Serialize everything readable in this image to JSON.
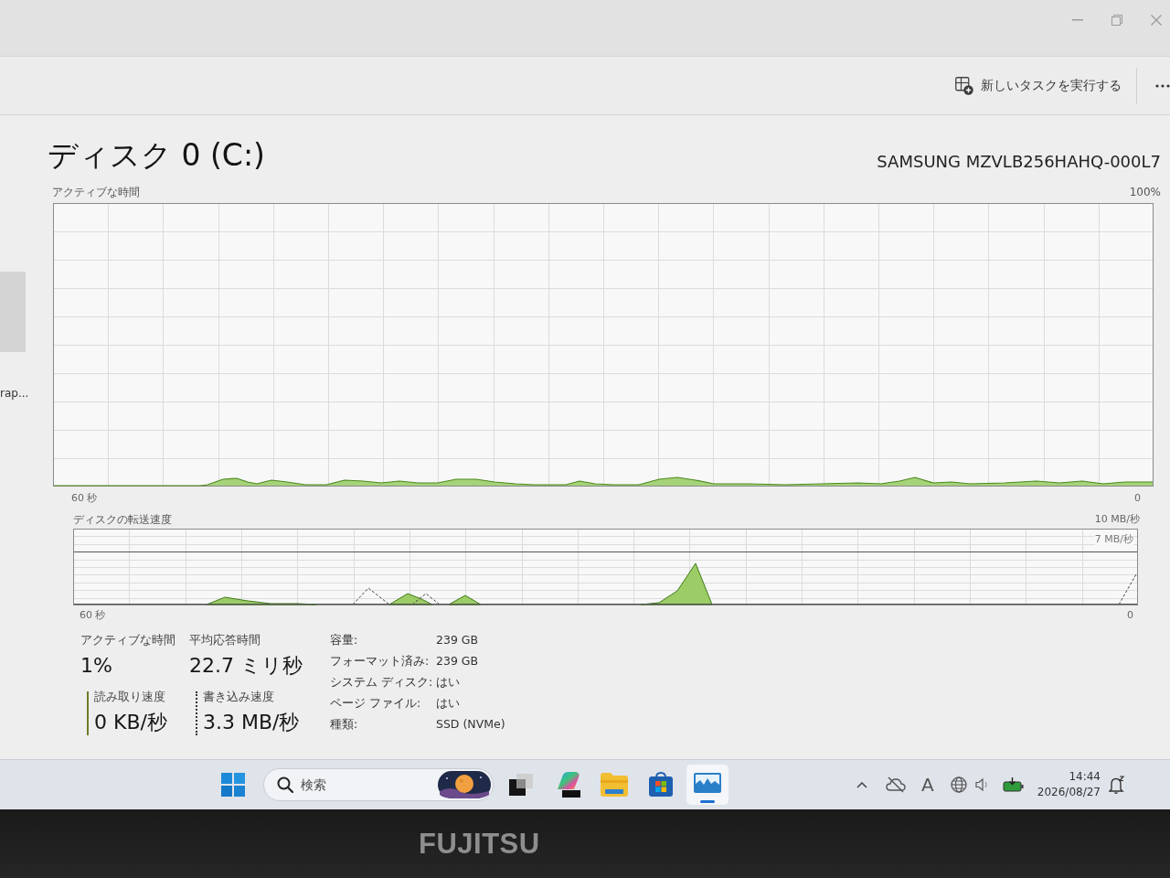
{
  "sidebar": {
    "items": [
      {
        "selected": true
      },
      {
        "label": "rap...",
        "selected": false
      }
    ]
  },
  "toolbar": {
    "run_task": "新しいタスクを実行する"
  },
  "header": {
    "title": "ディスク 0 (C:)",
    "model": "SAMSUNG MZVLB256HAHQ-000L7"
  },
  "active_time_graph": {
    "label": "アクティブな時間",
    "max": "100%",
    "span": "60 秒",
    "min": "0"
  },
  "transfer_graph": {
    "label": "ディスクの転送速度",
    "max": "10 MB/秒",
    "marker": "7 MB/秒",
    "span": "60 秒",
    "min": "0"
  },
  "metrics": [
    {
      "kind": "plain",
      "label": "アクティブな時間",
      "value": "1%"
    },
    {
      "kind": "plain",
      "label": "平均応答時間",
      "value": "22.7 ミリ秒"
    },
    {
      "kind": "solid",
      "label": "読み取り速度",
      "value": "0 KB/秒"
    },
    {
      "kind": "dotted",
      "label": "書き込み速度",
      "value": "3.3 MB/秒"
    }
  ],
  "properties": [
    {
      "label": "容量:",
      "value": "239 GB"
    },
    {
      "label": "フォーマット済み:",
      "value": "239 GB"
    },
    {
      "label": "システム ディスク:",
      "value": "はい"
    },
    {
      "label": "ページ ファイル:",
      "value": "はい"
    },
    {
      "label": "種類:",
      "value": "SSD (NVMe)"
    }
  ],
  "taskbar": {
    "search": {
      "placeholder": "検索"
    },
    "apps": [
      {
        "kind": "squares",
        "selected": false
      },
      {
        "kind": "colorful",
        "selected": false
      },
      {
        "kind": "folder",
        "selected": false
      },
      {
        "kind": "store",
        "selected": false
      },
      {
        "kind": "monitor",
        "selected": true
      }
    ],
    "tray": {
      "ime": "A",
      "time": "14:44",
      "date": "2026/08/27"
    }
  },
  "bezel": {
    "brand": "FUJITSU"
  }
}
